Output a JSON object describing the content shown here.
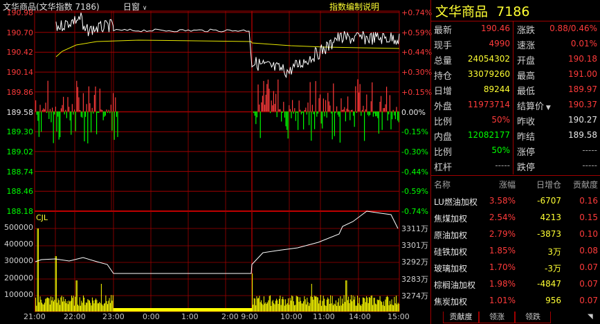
{
  "header": {
    "title": "文华商品(文华指数  7186)",
    "period": "日窗",
    "period_arrow": "∨",
    "link": "指数编制说明"
  },
  "axis": {
    "left_price": [
      "190.98",
      "190.70",
      "190.42",
      "190.14",
      "189.86",
      "189.58",
      "189.30",
      "189.02",
      "188.74",
      "188.46",
      "188.18"
    ],
    "right_pct": [
      "+0.74%",
      "+0.59%",
      "+0.44%",
      "+0.30%",
      "+0.15%",
      "0.00%",
      "-0.15%",
      "-0.30%",
      "-0.44%",
      "-0.59%",
      "-0.74%"
    ],
    "vol_label": "CJL",
    "left_vol": [
      "500000",
      "400000",
      "300000",
      "200000",
      "100000"
    ],
    "right_oi": [
      "3311万",
      "3301万",
      "3292万",
      "3283万",
      "3274万"
    ],
    "time": [
      "21:00",
      "22:00",
      "23:00",
      "0:00",
      "1:00",
      "2:00 9:00",
      "10:00",
      "11:00",
      "14:00",
      "15:00"
    ]
  },
  "quote": {
    "name": "文华商品",
    "code": "7186",
    "rows": [
      {
        "l1": "最新",
        "v1": "190.46",
        "l2": "涨跌",
        "v2": "0.88/0.46%"
      },
      {
        "l1": "现手",
        "v1": "4990",
        "l2": "速涨",
        "v2": "0.01%"
      },
      {
        "l1": "总量",
        "v1": "24054302",
        "l2": "开盘",
        "v2": "190.18"
      },
      {
        "l1": "持仓",
        "v1": "33079260",
        "l2": "最高",
        "v2": "191.00"
      },
      {
        "l1": "日增",
        "v1": "89244",
        "l2": "最低",
        "v2": "189.97"
      },
      {
        "l1": "外盘",
        "v1": "11973714",
        "l2": "结算价",
        "v2": "190.37"
      },
      {
        "l1": "比例",
        "v1": "50%",
        "l2": "昨收",
        "v2": "190.27"
      },
      {
        "l1": "内盘",
        "v1": "12082177",
        "l2": "昨结",
        "v2": "189.58"
      },
      {
        "l1": "比例",
        "v1": "50%",
        "l2": "涨停",
        "v2": "-----"
      },
      {
        "l1": "杠杆",
        "v1": "-----",
        "l2": "跌停",
        "v2": "-----"
      }
    ],
    "settle_arrow": "▼"
  },
  "contrib": {
    "headers": [
      "名称",
      "涨幅",
      "日增仓",
      "贡献度"
    ],
    "rows": [
      {
        "name": "LU燃油加权",
        "chg": "3.58%",
        "oi": "-6707",
        "contrib": "0.16"
      },
      {
        "name": "焦煤加权",
        "chg": "2.54%",
        "oi": "4213",
        "contrib": "0.15"
      },
      {
        "name": "原油加权",
        "chg": "2.79%",
        "oi": "-3873",
        "contrib": "0.10"
      },
      {
        "name": "硅铁加权",
        "chg": "1.85%",
        "oi": "3万",
        "contrib": "0.08"
      },
      {
        "name": "玻璃加权",
        "chg": "1.70%",
        "oi": "-3万",
        "contrib": "0.07"
      },
      {
        "name": "棕榈油加权",
        "chg": "1.98%",
        "oi": "-4847",
        "contrib": "0.07"
      },
      {
        "name": "焦炭加权",
        "chg": "1.01%",
        "oi": "956",
        "contrib": "0.07"
      }
    ]
  },
  "tabs": [
    "贡献度",
    "领涨",
    "领跌"
  ],
  "colors": {
    "up": "#ff3b3b",
    "down": "#00ff00",
    "grid": "#a00000",
    "price": "#ffffff",
    "avg": "#ffff33",
    "volume": "#ffff00"
  }
}
